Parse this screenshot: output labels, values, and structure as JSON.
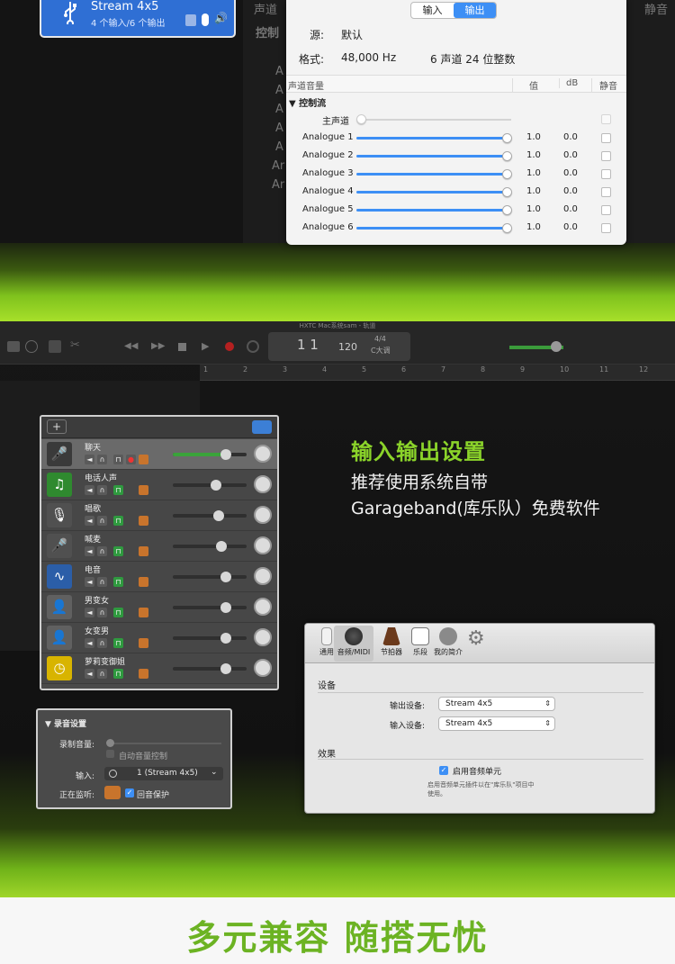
{
  "top": {
    "stream_card": {
      "title": "Stream 4x5",
      "subtitle": "4 个输入/6 个输出"
    },
    "ghost_labels": {
      "right1": "声道",
      "right2": "控制",
      "right3": "静音",
      "left_rows": [
        "A",
        "A",
        "A",
        "A",
        "A",
        "Ar",
        "Ar"
      ]
    },
    "audio_window": {
      "tabs": [
        {
          "label": "输入",
          "active": false
        },
        {
          "label": "输出",
          "active": true
        }
      ],
      "source_label": "源:",
      "source_value": "默认",
      "format_label": "格式:",
      "format_value": "48,000 Hz",
      "format_channels": "6 声道 24 位整数",
      "table_headers": {
        "volume": "声道音量",
        "value": "值",
        "db": "dB",
        "mute": "静音"
      },
      "group_label": "控制流",
      "master_label": "主声道",
      "channels": [
        {
          "name": "Analogue 1",
          "level": 1.0,
          "value": "1.0",
          "db": "0.0"
        },
        {
          "name": "Analogue 2",
          "level": 1.0,
          "value": "1.0",
          "db": "0.0"
        },
        {
          "name": "Analogue 3",
          "level": 1.0,
          "value": "1.0",
          "db": "0.0"
        },
        {
          "name": "Analogue 4",
          "level": 1.0,
          "value": "1.0",
          "db": "0.0"
        },
        {
          "name": "Analogue 5",
          "level": 1.0,
          "value": "1.0",
          "db": "0.0"
        },
        {
          "name": "Analogue 6",
          "level": 1.0,
          "value": "1.0",
          "db": "0.0"
        }
      ]
    }
  },
  "middle": {
    "window_title": "HXTC Mac系统sam - 轨道",
    "lcd": {
      "bar": "1 1",
      "tempo": "120",
      "sig": "4/4",
      "key": "C大调"
    },
    "ruler_marks": [
      "1",
      "2",
      "3",
      "4",
      "5",
      "6",
      "7",
      "8",
      "9",
      "10",
      "11",
      "12"
    ],
    "headline": "输入输出设置",
    "subline_1": "推荐使用系统自带",
    "subline_2": "Garageband(库乐队）免费软件",
    "tracks_panel": {
      "add_label": "+",
      "tracks": [
        {
          "name": "聊天",
          "color": "#3a3a3a",
          "glyph": "🎤",
          "selected": true,
          "volume": 0.72
        },
        {
          "name": "电话人声",
          "color": "#2f8a2f",
          "glyph": "♫",
          "selected": false,
          "volume": 0.58
        },
        {
          "name": "唱歌",
          "color": "#505050",
          "glyph": "🎙",
          "selected": false,
          "volume": 0.62
        },
        {
          "name": "喊麦",
          "color": "#505050",
          "glyph": "🎤",
          "selected": false,
          "volume": 0.66
        },
        {
          "name": "电音",
          "color": "#2b5ea8",
          "glyph": "∿",
          "selected": false,
          "volume": 0.72
        },
        {
          "name": "男变女",
          "color": "#606060",
          "glyph": "👤",
          "selected": false,
          "volume": 0.72
        },
        {
          "name": "女变男",
          "color": "#606060",
          "glyph": "👤",
          "selected": false,
          "volume": 0.72
        },
        {
          "name": "萝莉变御姐",
          "color": "#d8b400",
          "glyph": "◷",
          "selected": false,
          "volume": 0.72
        }
      ]
    },
    "record_panel": {
      "title": "▼ 录音设置",
      "volume_label": "录制音量:",
      "auto_label": "自动音量控制",
      "input_label": "输入:",
      "input_value": "1 (Stream 4x5)",
      "monitor_label": "正在监听:",
      "feedback_label": "回音保护"
    },
    "prefs": {
      "tabs": [
        "通用",
        "音频/MIDI",
        "节拍器",
        "乐段",
        "我的简介"
      ],
      "devices_header": "设备",
      "output_label": "输出设备:",
      "output_value": "Stream 4x5",
      "input_label": "输入设备:",
      "input_value": "Stream 4x5",
      "effects_header": "效果",
      "enable_label": "启用音频单元",
      "enable_note_1": "启用音频单元插件以在\"库乐队\"项目中",
      "enable_note_2": "使用。"
    }
  },
  "bottom": {
    "slogan": "多元兼容 随搭无忧"
  },
  "colors": {
    "accent_green": "#8bd42a",
    "mac_blue": "#3d8ff5",
    "slogan_green": "#6cb323"
  }
}
